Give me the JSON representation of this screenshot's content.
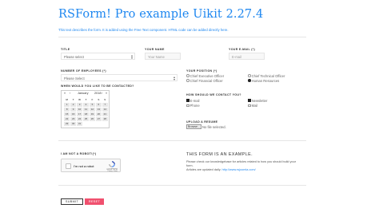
{
  "page": {
    "title": "RSForm! Pro example Uikit 2.27.4",
    "intro_prefix": "This text describes the form. It is added using the Free Text component. ",
    "intro_suffix": "HTML code can be added directly here."
  },
  "form": {
    "title": {
      "label": "Title",
      "value": "Please select"
    },
    "name": {
      "label": "Your Name",
      "placeholder": "Your Name"
    },
    "email": {
      "label": "Your E-mail (*)",
      "placeholder": "E-mail"
    },
    "employees": {
      "label": "Number of Employees (*)",
      "value": "Please Select"
    },
    "contact_date": {
      "label": "When would you like to be contacted?"
    },
    "position": {
      "label": "Your Position (*)",
      "options": [
        {
          "label": "Chief Executive Officer",
          "checked": false
        },
        {
          "label": "Chief Technical Officer",
          "checked": false
        },
        {
          "label": "Chief Financial Officer",
          "checked": false
        },
        {
          "label": "Human Resources",
          "checked": true
        }
      ]
    },
    "contact_method": {
      "label": "How should we contact you?",
      "options": [
        {
          "label": "E-mail",
          "checked": true
        },
        {
          "label": "Newsletter",
          "checked": true
        },
        {
          "label": "Phone",
          "checked": false
        },
        {
          "label": "Mail",
          "checked": false
        }
      ]
    },
    "resume": {
      "label": "Upload a Resume",
      "button": "Browse...",
      "status": "No file selected."
    },
    "robot": {
      "label": "I am not a robot!(*)",
      "checkbox_text": "I'm not a robot",
      "brand": "reCAPTCHA",
      "terms": "Privacy - Terms"
    },
    "submit_label": "Submit",
    "reset_label": "Reset"
  },
  "calendar": {
    "prev": "«",
    "prev_small": "‹",
    "month": "January",
    "year": "2018",
    "next_small": "›",
    "next": "»",
    "weekdays": [
      "M",
      "T",
      "W",
      "T",
      "F",
      "S",
      "S"
    ],
    "days": [
      "1",
      "2",
      "3",
      "4",
      "5",
      "6",
      "7",
      "8",
      "9",
      "10",
      "11",
      "12",
      "13",
      "14",
      "15",
      "16",
      "17",
      "18",
      "19",
      "20",
      "21",
      "22",
      "23",
      "24",
      "25",
      "26",
      "27",
      "28",
      "29",
      "30",
      "31"
    ]
  },
  "aside": {
    "heading": "This form is an example.",
    "line1": "Please check our knowledgebase for articles related to how you should build your",
    "line2": "form.",
    "line3_prefix": "Articles are updated daily. ",
    "line3_link": "http://www.rsjoomla.com/"
  },
  "colors": {
    "accent": "#1e87f0",
    "reset": "#f0506e"
  }
}
